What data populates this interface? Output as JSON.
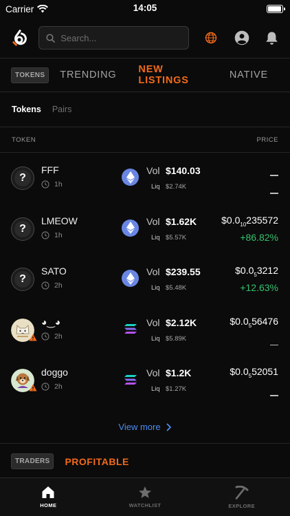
{
  "status_bar": {
    "carrier": "Carrier",
    "time": "14:05",
    "battery_level": 0.95
  },
  "header": {
    "search_placeholder": "Search..."
  },
  "category": {
    "badge": "TOKENS",
    "tabs": [
      "TRENDING",
      "NEW LISTINGS",
      "NATIVE"
    ],
    "active_tab": "NEW LISTINGS"
  },
  "sub_tabs": {
    "items": [
      "Tokens",
      "Pairs"
    ],
    "active": "Tokens"
  },
  "table_header": {
    "token": "TOKEN",
    "price": "PRICE"
  },
  "labels": {
    "vol": "Vol",
    "liq": "Liq"
  },
  "tokens": [
    {
      "name": "FFF",
      "age": "1h",
      "chain": "ethereum",
      "vol": "$140.03",
      "liq": "$2.74K",
      "price_prefix": "",
      "price_sub": "",
      "price_digits": "",
      "change": ""
    },
    {
      "name": "LMEOW",
      "age": "1h",
      "chain": "ethereum",
      "vol": "$1.62K",
      "liq": "$5.57K",
      "price_prefix": "$0.0",
      "price_sub": "10",
      "price_digits": "235572",
      "change": "+86.82%"
    },
    {
      "name": "SATO",
      "age": "2h",
      "chain": "ethereum",
      "vol": "$239.55",
      "liq": "$5.48K",
      "price_prefix": "$0.0",
      "price_sub": "5",
      "price_digits": "3212",
      "change": "+12.63%"
    },
    {
      "name": "◕‿◕",
      "age": "2h",
      "chain": "solana",
      "vol": "$2.12K",
      "liq": "$5.89K",
      "price_prefix": "$0.0",
      "price_sub": "5",
      "price_digits": "56476",
      "change": ""
    },
    {
      "name": "doggo",
      "age": "2h",
      "chain": "solana",
      "vol": "$1.2K",
      "liq": "$1.27K",
      "price_prefix": "$0.0",
      "price_sub": "5",
      "price_digits": "52051",
      "change": ""
    }
  ],
  "view_more": "View more",
  "traders": {
    "badge": "TRADERS",
    "tab": "PROFITABLE"
  },
  "bottom_nav": [
    {
      "label": "HOME",
      "icon": "home-icon",
      "active": true
    },
    {
      "label": "WATCHLIST",
      "icon": "star-icon",
      "active": false
    },
    {
      "label": "EXPLORE",
      "icon": "pickaxe-icon",
      "active": false
    }
  ],
  "colors": {
    "accent": "#f26a1b",
    "positive": "#35c26d",
    "link": "#4d8df0"
  }
}
